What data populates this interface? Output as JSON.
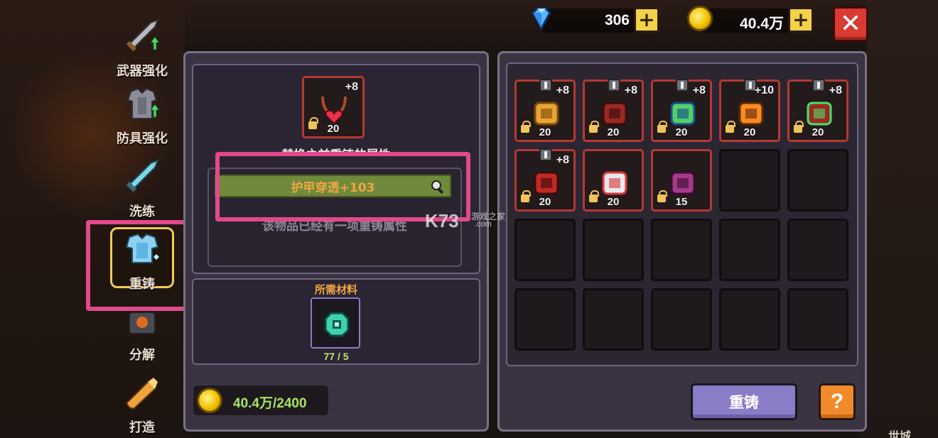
{
  "currency": {
    "gems": "306",
    "gold": "40.4万",
    "add_symbol": "+"
  },
  "close_symbol": "✕",
  "nav": [
    {
      "label": "武器强化",
      "icon": "sword-upgrade-icon"
    },
    {
      "label": "防具强化",
      "icon": "armor-upgrade-icon"
    },
    {
      "label": "洗练",
      "icon": "refine-icon"
    },
    {
      "label": "重铸",
      "icon": "reforge-icon",
      "active": true
    },
    {
      "label": "分解",
      "icon": "dismantle-icon"
    },
    {
      "label": "打造",
      "icon": "craft-icon"
    }
  ],
  "selected_item": {
    "level": "+8",
    "qty": "20",
    "icon": "heart-necklace-icon"
  },
  "detail": {
    "header_partial": "替换之前重铸的属性",
    "stat": "护甲穿透+103",
    "note": "该物品已经有一项重铸属性"
  },
  "materials": {
    "title": "所需材料",
    "count": "77 / 5",
    "icon": "reforge-gem-icon"
  },
  "cost": "40.4万/2400",
  "inventory": [
    {
      "level": "+8",
      "qty": "20",
      "icon": "robe-icon",
      "pin": true
    },
    {
      "level": "+8",
      "qty": "20",
      "icon": "helmet-icon",
      "pin": true
    },
    {
      "level": "+8",
      "qty": "20",
      "icon": "gem-ring-icon",
      "pin": true
    },
    {
      "level": "+10",
      "qty": "20",
      "icon": "fire-icon",
      "pin": true
    },
    {
      "level": "+8",
      "qty": "20",
      "icon": "check-amulet-icon",
      "pin": true
    },
    {
      "level": "+8",
      "qty": "20",
      "icon": "boots-icon",
      "pin": true
    },
    {
      "level": "",
      "qty": "20",
      "icon": "cloak-icon",
      "pin": false
    },
    {
      "level": "",
      "qty": "15",
      "icon": "crest-icon",
      "pin": false
    }
  ],
  "buttons": {
    "reforge": "重铸",
    "help": "?"
  },
  "watermark": {
    "logo": "K73",
    "site": "游戏之家",
    "domain": ".com"
  },
  "corner_label": "世城",
  "colors": {
    "accent": "#8a7cc6",
    "stat_bar": "#6f8a3a",
    "highlight": "#e04a8d"
  }
}
